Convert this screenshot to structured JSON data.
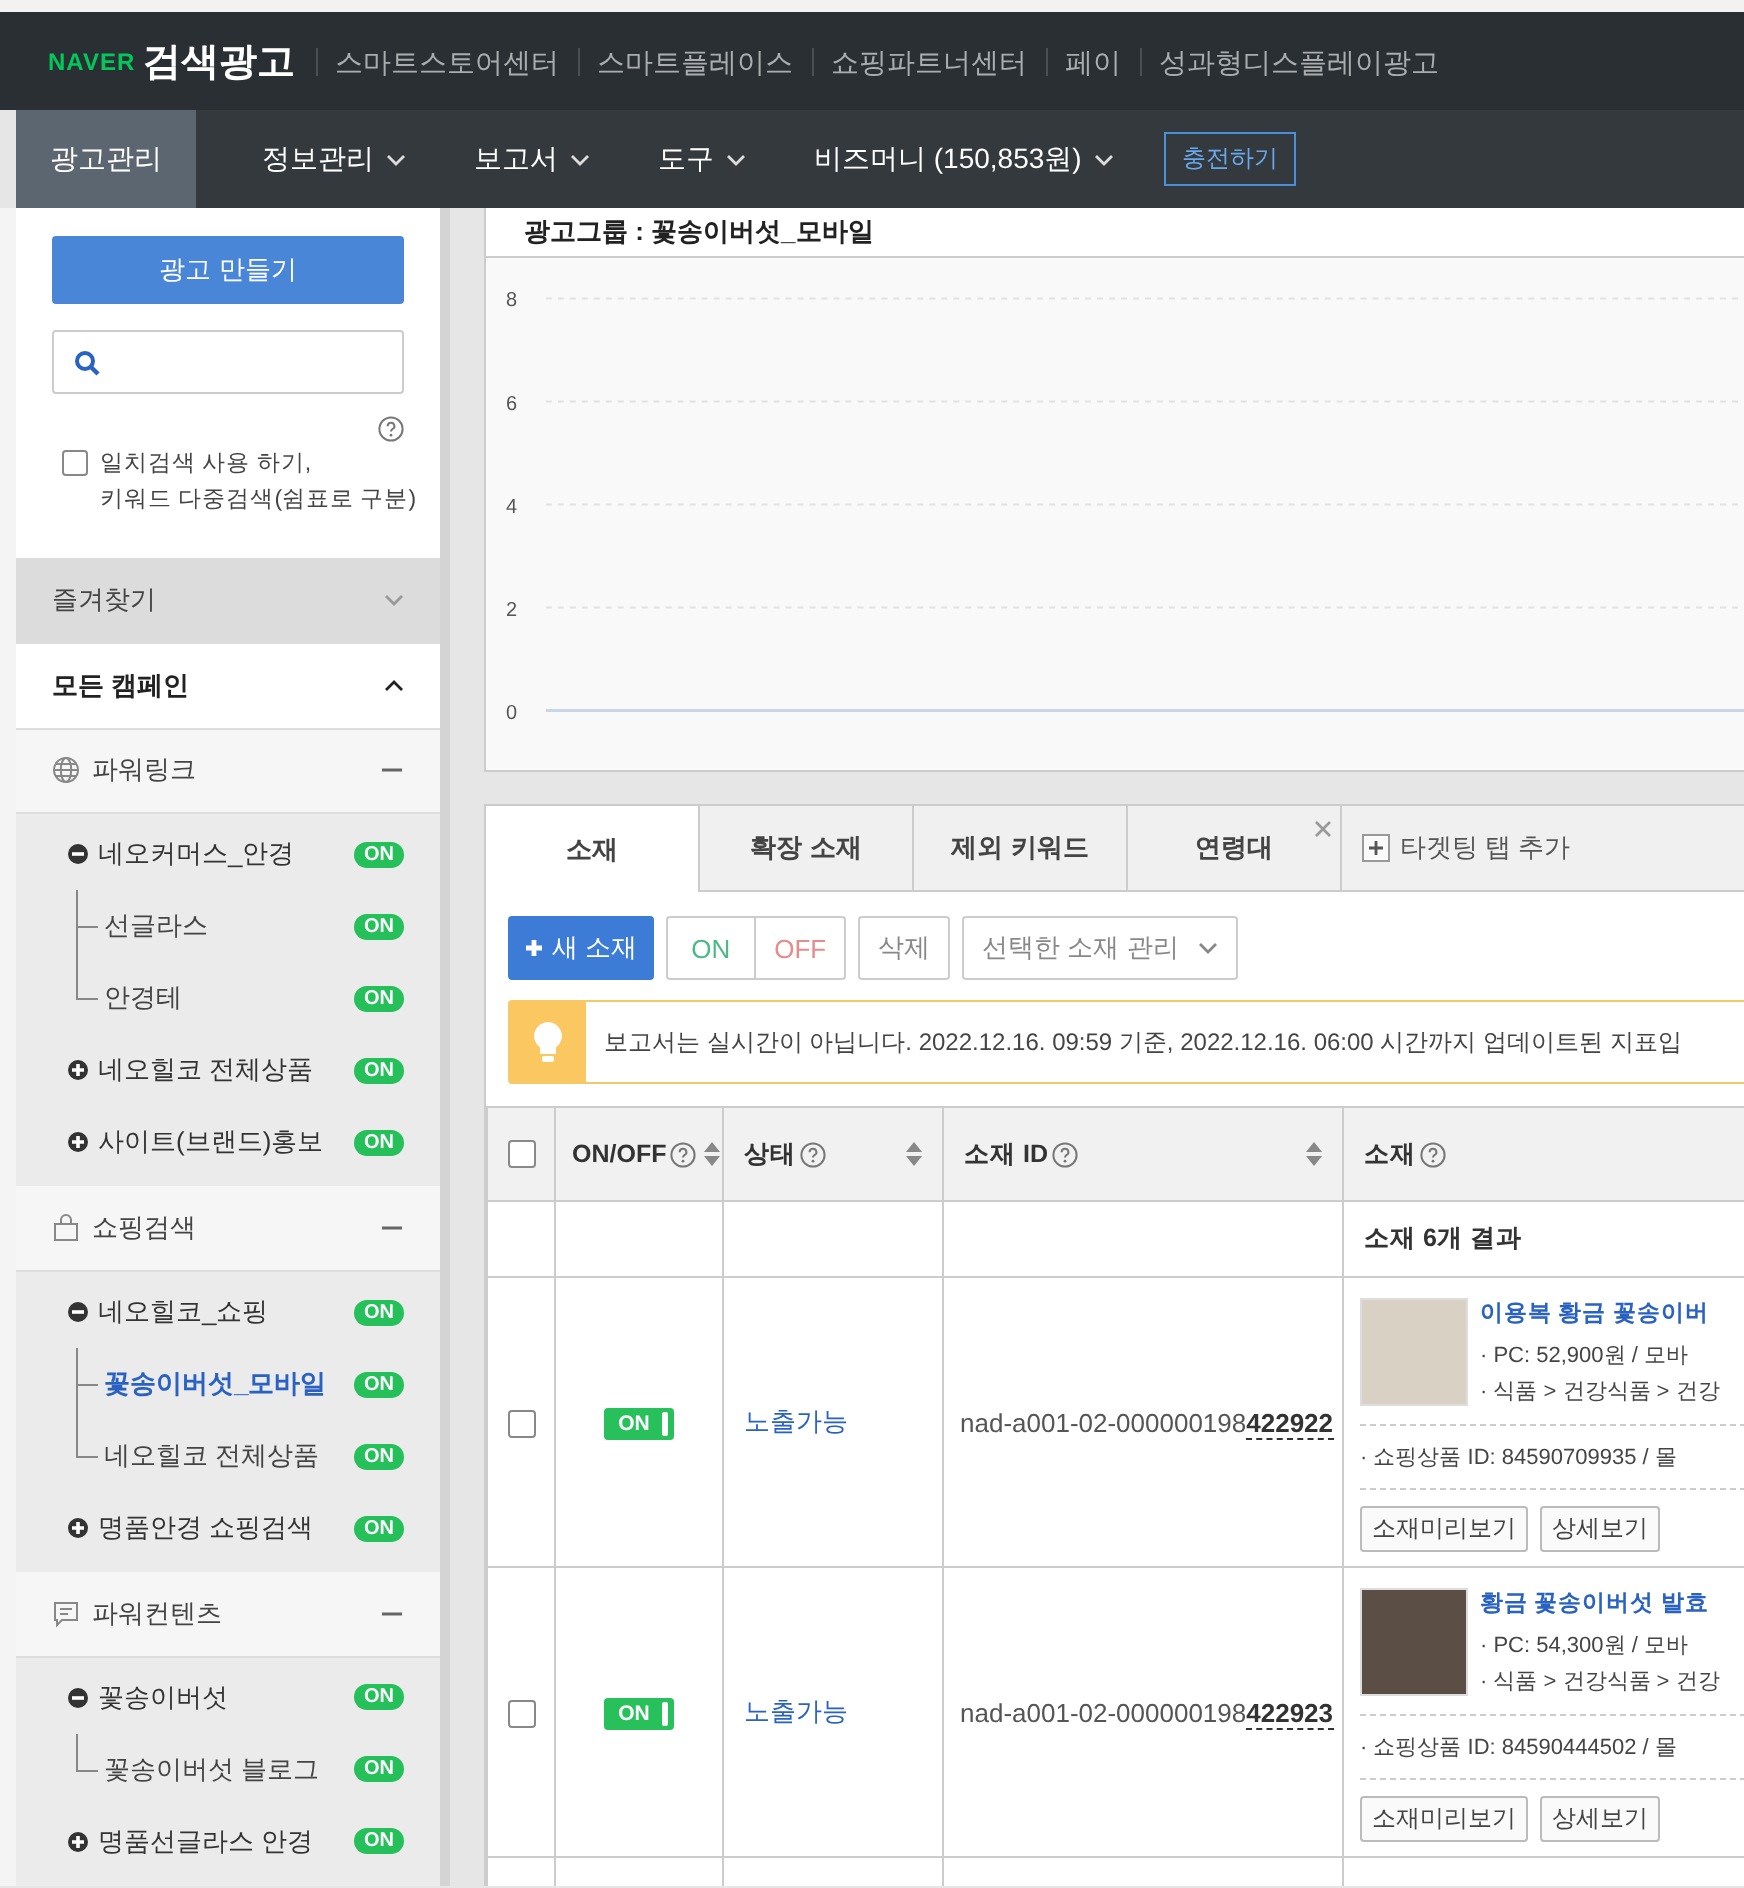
{
  "header": {
    "logo_brand": "NAVER",
    "logo_product": "검색광고",
    "links": [
      "스마트스토어센터",
      "스마트플레이스",
      "쇼핑파트너센터",
      "페이",
      "성과형디스플레이광고"
    ]
  },
  "nav": {
    "items": [
      {
        "label": "광고관리",
        "selected": true,
        "dropdown": false
      },
      {
        "label": "정보관리",
        "selected": false,
        "dropdown": true
      },
      {
        "label": "보고서",
        "selected": false,
        "dropdown": true
      },
      {
        "label": "도구",
        "selected": false,
        "dropdown": true
      },
      {
        "label": "비즈머니 (150,853원)",
        "selected": false,
        "dropdown": true
      }
    ],
    "charge_button": "충전하기"
  },
  "sidebar": {
    "create_button": "광고 만들기",
    "exact_search": {
      "checked": false,
      "label": "일치검색 사용 하기,\n키워드 다중검색(쉼표로 구분)"
    },
    "favorites": {
      "label": "즐겨찾기",
      "expanded": false
    },
    "all_campaigns": {
      "label": "모든 캠페인",
      "expanded": true,
      "groups": [
        {
          "kind": "powerlink",
          "label": "파워링크",
          "expanded": true,
          "campaigns": [
            {
              "label": "네오커머스_안경",
              "status": "ON",
              "expanded": true,
              "children": [
                {
                  "label": "선글라스",
                  "status": "ON",
                  "selected": false
                },
                {
                  "label": "안경테",
                  "status": "ON",
                  "selected": false
                }
              ]
            },
            {
              "label": "네오힐코 전체상품",
              "status": "ON",
              "expanded": false
            },
            {
              "label": "사이트(브랜드)홍보",
              "status": "ON",
              "expanded": false
            }
          ]
        },
        {
          "kind": "shopping",
          "label": "쇼핑검색",
          "expanded": true,
          "campaigns": [
            {
              "label": "네오힐코_쇼핑",
              "status": "ON",
              "expanded": true,
              "children": [
                {
                  "label": "꽃송이버섯_모바일",
                  "status": "ON",
                  "selected": true
                },
                {
                  "label": "네오힐코 전체상품",
                  "status": "ON",
                  "selected": false
                }
              ]
            },
            {
              "label": "명품안경 쇼핑검색",
              "status": "ON",
              "expanded": false
            }
          ]
        },
        {
          "kind": "content",
          "label": "파워컨텐츠",
          "expanded": true,
          "campaigns": [
            {
              "label": "꽃송이버섯",
              "status": "ON",
              "expanded": true,
              "children": [
                {
                  "label": "꽃송이버섯 블로그",
                  "status": "ON",
                  "selected": false
                }
              ]
            },
            {
              "label": "명품선글라스 안경",
              "status": "ON",
              "expanded": false
            }
          ]
        }
      ]
    }
  },
  "chart_panel": {
    "title": "광고그룹 : 꽃송이버섯_모바일",
    "chart_data": {
      "type": "line",
      "grid": true,
      "yticks": [
        0,
        2,
        4,
        6,
        8
      ],
      "ylim": [
        0,
        8
      ],
      "series": [
        {
          "color": "#c9d6ea",
          "values": [
            0,
            0,
            0,
            0,
            0,
            0,
            0
          ]
        }
      ]
    }
  },
  "tabs": [
    {
      "label": "소재",
      "selected": true,
      "closable": false
    },
    {
      "label": "확장 소재",
      "selected": false,
      "closable": false
    },
    {
      "label": "제외 키워드",
      "selected": false,
      "closable": false
    },
    {
      "label": "연령대",
      "selected": false,
      "closable": true
    }
  ],
  "add_tab": "타겟팅 탭 추가",
  "toolbar": {
    "new_button": "새 소재",
    "on_button": "ON",
    "off_button": "OFF",
    "delete_button": "삭제",
    "manage_dropdown": "선택한 소재 관리"
  },
  "notice": "보고서는 실시간이 아닙니다. 2022.12.16. 09:59 기준, 2022.12.16. 06:00 시간까지 업데이트된 지표입",
  "table": {
    "select_all": {
      "checked": false
    },
    "columns": [
      {
        "label": "ON/OFF",
        "help": true,
        "sortable": true
      },
      {
        "label": "상태",
        "help": true,
        "sortable": true
      },
      {
        "label": "소재 ID",
        "help": true,
        "sortable": true
      },
      {
        "label": "소재",
        "help": true,
        "sortable": false
      }
    ],
    "summary": "소재 6개 결과",
    "rows": [
      {
        "checked": false,
        "on": true,
        "toggle_label": "ON",
        "status": "노출가능",
        "id": "nad-a001-02-000000198**422922**",
        "title": "이용복 황금 꽃송이버",
        "price": "· PC: 52,900원 /  모바",
        "category": "· 식품 > 건강식품 > 건강",
        "product_id": "· 쇼핑상품 ID: 84590709935   / 몰",
        "buttons": [
          "소재미리보기",
          "상세보기"
        ]
      },
      {
        "checked": false,
        "on": true,
        "toggle_label": "ON",
        "status": "노출가능",
        "id": "nad-a001-02-000000198**422923**",
        "title": "황금 꽃송이버섯 발효",
        "price": "· PC: 54,300원 /  모바",
        "category": "· 식품 > 건강식품 > 건강",
        "product_id": "· 쇼핑상품 ID: 84590444502   / 몰",
        "buttons": [
          "소재미리보기",
          "상세보기"
        ]
      }
    ]
  }
}
